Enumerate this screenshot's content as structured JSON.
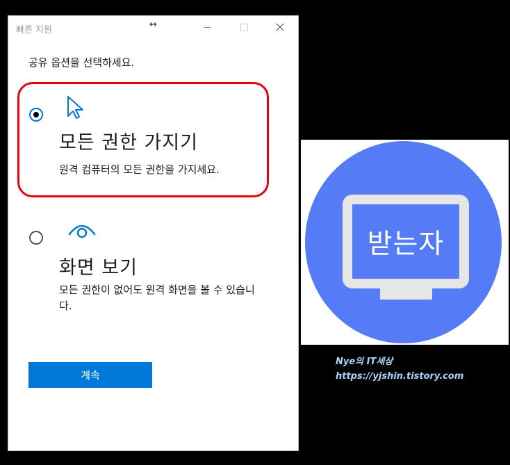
{
  "window": {
    "title": "빠른 지원",
    "prompt": "공유 옵션을 선택하세요.",
    "options": [
      {
        "title": "모든 권한 가지기",
        "description": "원격 컴퓨터의 모든 권한을 가지세요.",
        "selected": true,
        "icon": "cursor-icon"
      },
      {
        "title": "화면 보기",
        "description": "모든 권한이 없어도 원격 화면을 볼 수 있습니다.",
        "selected": false,
        "icon": "eye-icon"
      }
    ],
    "continue_label": "계속"
  },
  "receiver": {
    "label": "받는자",
    "circle_color": "#567bf7"
  },
  "watermark": {
    "line1": "Nye의 IT세상",
    "line2": "https://yjshin.tistory.com"
  },
  "colors": {
    "accent": "#0078d7",
    "highlight": "#e8000b"
  }
}
